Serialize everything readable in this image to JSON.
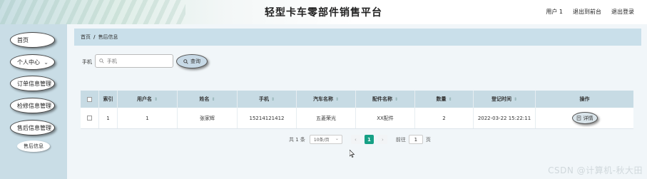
{
  "header": {
    "title": "轻型卡车零部件销售平台",
    "links": [
      "用户 1",
      "退出到前台",
      "退出登录"
    ]
  },
  "sidebar": {
    "items": [
      {
        "label": "首页",
        "has_chevron": false
      },
      {
        "label": "个人中心",
        "has_chevron": true
      },
      {
        "label": "订单信息管理",
        "has_chevron": false
      },
      {
        "label": "检修信息管理",
        "has_chevron": false
      },
      {
        "label": "售后信息管理",
        "has_chevron": false
      }
    ],
    "sub_item": "售后信息"
  },
  "breadcrumb": {
    "home": "首页",
    "separator": "/",
    "current": "售后信息"
  },
  "search": {
    "label": "手机",
    "placeholder": "手机",
    "button": "查询"
  },
  "table": {
    "columns": [
      "",
      "索引",
      "用户名",
      "姓名",
      "手机",
      "汽车名称",
      "配件名称",
      "数量",
      "登记时间",
      "操作"
    ],
    "rows": [
      {
        "index": "1",
        "username": "1",
        "name": "张家辉",
        "phone": "15214121412",
        "car": "五菱荣光",
        "part": "XX配件",
        "qty": "2",
        "time": "2022-03-22 15:22:11",
        "action": "详情"
      }
    ]
  },
  "pagination": {
    "total": "共 1 条",
    "page_size": "10条/页",
    "current": "1",
    "goto_label": "前往",
    "goto_value": "1",
    "page_suffix": "页"
  },
  "watermark": "CSDN @计算机-秋大田",
  "colors": {
    "accent": "#16a085",
    "header_row": "#c7dbe4",
    "sidebar": "#c9dde6"
  }
}
